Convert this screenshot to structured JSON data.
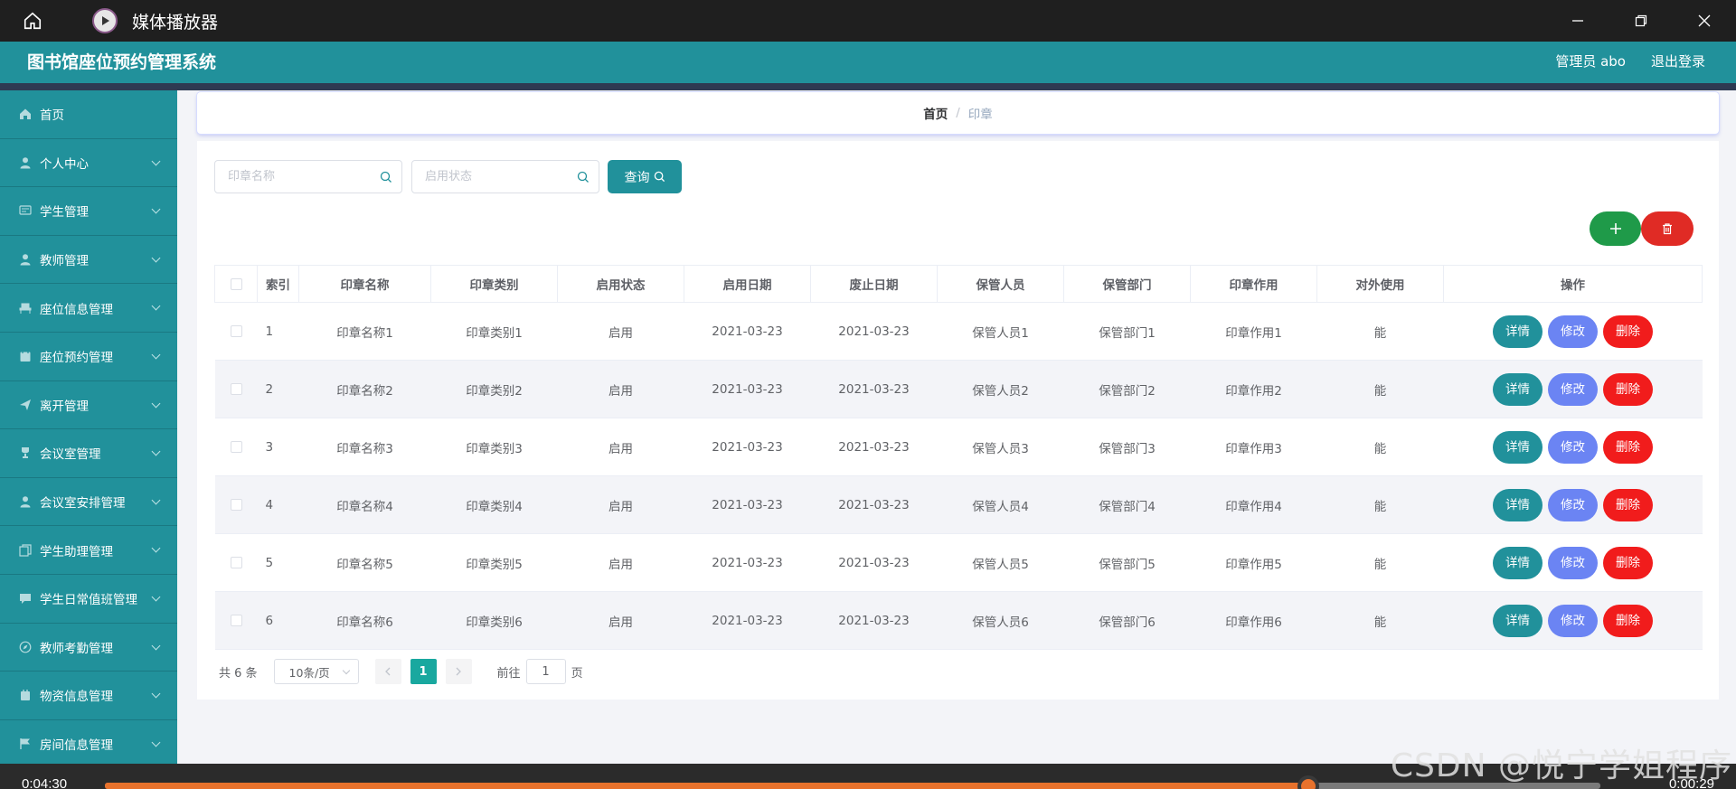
{
  "player": {
    "title": "媒体播放器",
    "time_elapsed": "0:04:30",
    "time_remaining": "0:00:29",
    "progress_percent": 80.5
  },
  "app": {
    "brand": "图书馆座位预约管理系统",
    "user": "管理员 abo",
    "logout": "退出登录"
  },
  "sidebar": {
    "items": [
      {
        "label": "首页",
        "icon": "home-icon",
        "has_submenu": false
      },
      {
        "label": "个人中心",
        "icon": "user-icon",
        "has_submenu": true
      },
      {
        "label": "学生管理",
        "icon": "message-icon",
        "has_submenu": true
      },
      {
        "label": "教师管理",
        "icon": "user-icon",
        "has_submenu": true
      },
      {
        "label": "座位信息管理",
        "icon": "chair-icon",
        "has_submenu": true
      },
      {
        "label": "座位预约管理",
        "icon": "calendar-icon",
        "has_submenu": true
      },
      {
        "label": "离开管理",
        "icon": "send-icon",
        "has_submenu": true
      },
      {
        "label": "会议室管理",
        "icon": "trophy-icon",
        "has_submenu": true
      },
      {
        "label": "会议室安排管理",
        "icon": "user-icon",
        "has_submenu": true
      },
      {
        "label": "学生助理管理",
        "icon": "copy-icon",
        "has_submenu": true
      },
      {
        "label": "学生日常值班管理",
        "icon": "chat-icon",
        "has_submenu": true
      },
      {
        "label": "教师考勤管理",
        "icon": "compass-icon",
        "has_submenu": true
      },
      {
        "label": "物资信息管理",
        "icon": "box-icon",
        "has_submenu": true
      },
      {
        "label": "房间信息管理",
        "icon": "flag-icon",
        "has_submenu": true
      }
    ]
  },
  "breadcrumb": {
    "home": "首页",
    "separator": "/",
    "current": "印章"
  },
  "search": {
    "name_placeholder": "印章名称",
    "status_placeholder": "启用状态",
    "query_label": "查询"
  },
  "table": {
    "columns": [
      "索引",
      "印章名称",
      "印章类别",
      "启用状态",
      "启用日期",
      "废止日期",
      "保管人员",
      "保管部门",
      "印章作用",
      "对外使用",
      "操作"
    ],
    "rows": [
      {
        "index": "1",
        "name": "印章名称1",
        "category": "印章类别1",
        "status": "启用",
        "start": "2021-03-23",
        "end": "2021-03-23",
        "keeper": "保管人员1",
        "dept": "保管部门1",
        "purpose": "印章作用1",
        "external": "能"
      },
      {
        "index": "2",
        "name": "印章名称2",
        "category": "印章类别2",
        "status": "启用",
        "start": "2021-03-23",
        "end": "2021-03-23",
        "keeper": "保管人员2",
        "dept": "保管部门2",
        "purpose": "印章作用2",
        "external": "能"
      },
      {
        "index": "3",
        "name": "印章名称3",
        "category": "印章类别3",
        "status": "启用",
        "start": "2021-03-23",
        "end": "2021-03-23",
        "keeper": "保管人员3",
        "dept": "保管部门3",
        "purpose": "印章作用3",
        "external": "能"
      },
      {
        "index": "4",
        "name": "印章名称4",
        "category": "印章类别4",
        "status": "启用",
        "start": "2021-03-23",
        "end": "2021-03-23",
        "keeper": "保管人员4",
        "dept": "保管部门4",
        "purpose": "印章作用4",
        "external": "能"
      },
      {
        "index": "5",
        "name": "印章名称5",
        "category": "印章类别5",
        "status": "启用",
        "start": "2021-03-23",
        "end": "2021-03-23",
        "keeper": "保管人员5",
        "dept": "保管部门5",
        "purpose": "印章作用5",
        "external": "能"
      },
      {
        "index": "6",
        "name": "印章名称6",
        "category": "印章类别6",
        "status": "启用",
        "start": "2021-03-23",
        "end": "2021-03-23",
        "keeper": "保管人员6",
        "dept": "保管部门6",
        "purpose": "印章作用6",
        "external": "能"
      }
    ],
    "actions": {
      "detail": "详情",
      "edit": "修改",
      "delete": "删除"
    }
  },
  "pagination": {
    "total": "共 6 条",
    "page_size": "10条/页",
    "current_page": "1",
    "goto_label": "前往",
    "goto_value": "1",
    "page_suffix": "页"
  },
  "watermark": "CSDN @悦宁学姐程序",
  "colors": {
    "primary": "#21919b",
    "add": "#1f9a49",
    "delete": "#e02b25",
    "edit": "#6b84f3",
    "progress": "#e8722c"
  }
}
